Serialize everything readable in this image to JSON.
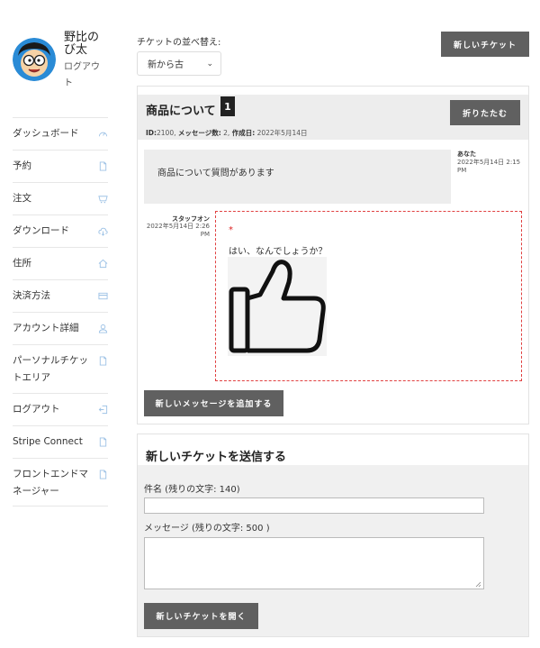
{
  "user": {
    "name": "野比のび太",
    "logout_link": "ログアウト"
  },
  "sidebar": {
    "items": [
      {
        "label": "ダッシュボード",
        "icon": "dashboard-icon"
      },
      {
        "label": "予約",
        "icon": "file-icon"
      },
      {
        "label": "注文",
        "icon": "basket-icon"
      },
      {
        "label": "ダウンロード",
        "icon": "cloud-download-icon"
      },
      {
        "label": "住所",
        "icon": "home-icon"
      },
      {
        "label": "決済方法",
        "icon": "credit-card-icon"
      },
      {
        "label": "アカウント詳細",
        "icon": "user-icon"
      },
      {
        "label": "パーソナルチケットエリア",
        "icon": "file-icon"
      },
      {
        "label": "ログアウト",
        "icon": "logout-icon"
      },
      {
        "label": "Stripe Connect",
        "icon": "file-icon"
      },
      {
        "label": "フロントエンドマネージャー",
        "icon": "file-icon"
      }
    ]
  },
  "sort": {
    "label": "チケットの並べ替え:",
    "selected": "新から古"
  },
  "new_ticket_button": "新しいチケット",
  "ticket": {
    "title": "商品について",
    "message_count_badge": "1",
    "collapse_button": "折りたたむ",
    "meta_id_label": "ID:",
    "meta_id": "2100",
    "meta_messages_label": "メッセージ数:",
    "meta_messages": "2",
    "meta_created_label": "作成日:",
    "meta_created": "2022年5月14日",
    "messages": [
      {
        "author": "あなた",
        "date": "2022年5月14日 2:15 PM",
        "text": "商品について質問があります"
      },
      {
        "author": "スタッフオン",
        "date": "2022年5月14日 2:26 PM",
        "marker": "*",
        "text": "はい、なんでしょうか？"
      }
    ],
    "add_message_button": "新しいメッセージを追加する"
  },
  "new_ticket_form": {
    "title": "新しいチケットを送信する",
    "subject_label": "件名 (残りの文字: 140)",
    "subject_value": "",
    "message_label": "メッセージ (残りの文字: 500 )",
    "message_value": "",
    "submit_button": "新しいチケットを開く"
  },
  "colors": {
    "button_bg": "#606060",
    "panel_bg": "#ededed",
    "staff_border": "#e04040",
    "menu_icon": "#9fc3e6"
  }
}
